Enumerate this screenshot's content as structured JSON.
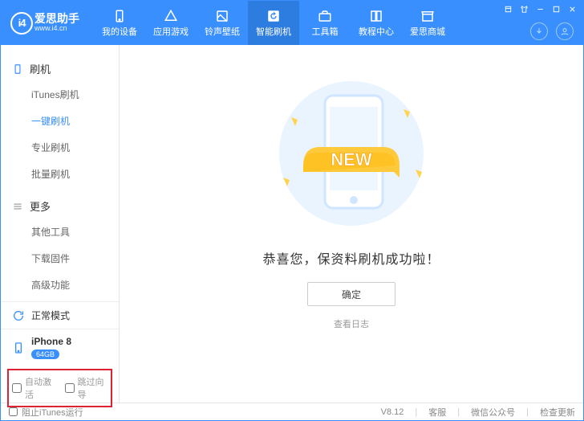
{
  "logo": {
    "cn": "爱思助手",
    "url": "www.i4.cn"
  },
  "nav": [
    {
      "label": "我的设备"
    },
    {
      "label": "应用游戏"
    },
    {
      "label": "铃声壁纸"
    },
    {
      "label": "智能刷机"
    },
    {
      "label": "工具箱"
    },
    {
      "label": "教程中心"
    },
    {
      "label": "爱思商城"
    }
  ],
  "sidebar": {
    "group1": {
      "head": "刷机",
      "items": [
        "iTunes刷机",
        "一键刷机",
        "专业刷机",
        "批量刷机"
      ]
    },
    "group2": {
      "head": "更多",
      "items": [
        "其他工具",
        "下载固件",
        "高级功能"
      ]
    },
    "mode": "正常模式",
    "device": {
      "name": "iPhone 8",
      "storage": "64GB"
    },
    "opts": {
      "auto": "自动激活",
      "skip": "跳过向导"
    }
  },
  "main": {
    "illus_new": "NEW",
    "title": "恭喜您，保资料刷机成功啦！",
    "ok": "确定",
    "view_log": "查看日志"
  },
  "status": {
    "block_itunes": "阻止iTunes运行",
    "version": "V8.12",
    "support": "客服",
    "wechat": "微信公众号",
    "update": "检查更新"
  }
}
